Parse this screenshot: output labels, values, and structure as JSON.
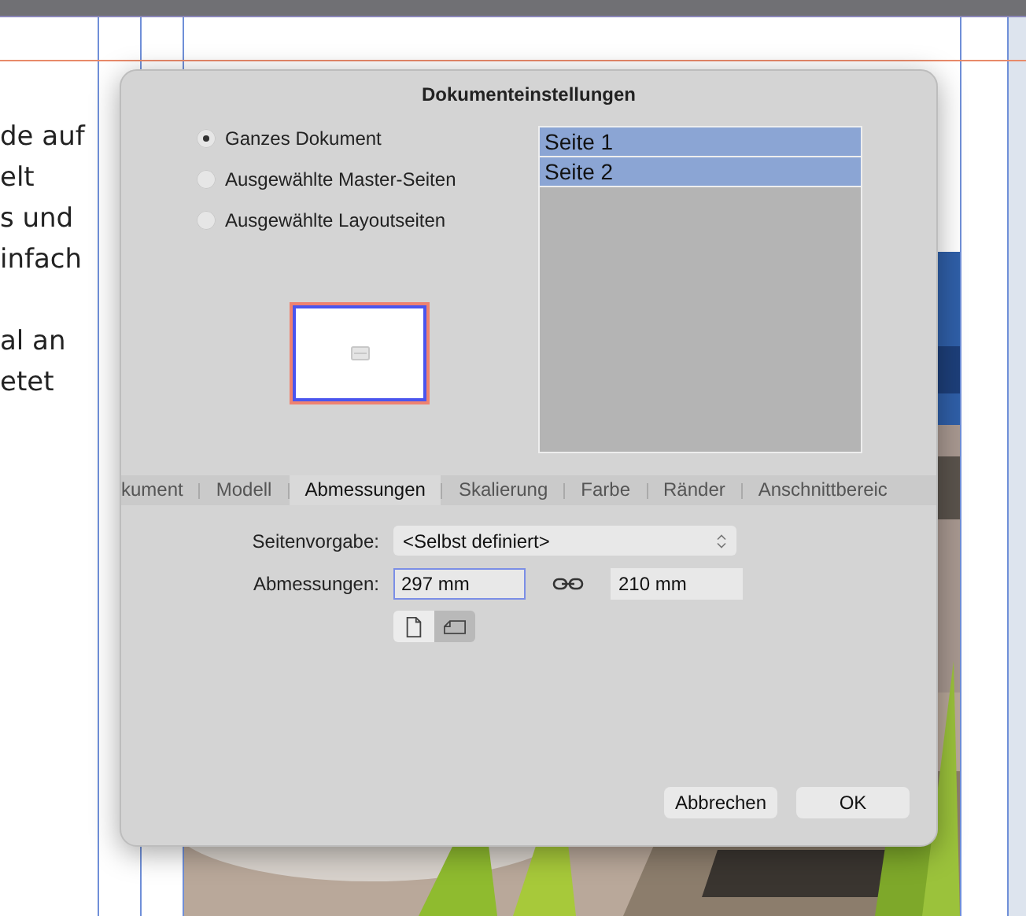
{
  "document": {
    "paragraphs": [
      [
        "de auf",
        "elt",
        "s und",
        "infach"
      ],
      [
        "al an",
        "etet"
      ]
    ]
  },
  "dialog": {
    "title": "Dokumenteinstellungen",
    "scope_options": [
      {
        "label": "Ganzes Dokument",
        "selected": true
      },
      {
        "label": "Ausgewählte Master-Seiten",
        "selected": false
      },
      {
        "label": "Ausgewählte Layoutseiten",
        "selected": false
      }
    ],
    "pages": [
      {
        "label": "Seite 1",
        "selected": true
      },
      {
        "label": "Seite 2",
        "selected": true
      }
    ],
    "tabs": [
      {
        "label": "kument",
        "selected": false
      },
      {
        "label": "Modell",
        "selected": false
      },
      {
        "label": "Abmessungen",
        "selected": true
      },
      {
        "label": "Skalierung",
        "selected": false
      },
      {
        "label": "Farbe",
        "selected": false
      },
      {
        "label": "Ränder",
        "selected": false
      },
      {
        "label": "Anschnittbereic",
        "selected": false
      }
    ],
    "fields": [
      {
        "kind": "select",
        "label": "Seitenvorgabe:",
        "value": "<Selbst definiert>"
      },
      {
        "kind": "size",
        "label": "Abmessungen:",
        "values": [
          {
            "value": "297 mm",
            "focused": true
          },
          {
            "value": "210 mm",
            "focused": false
          }
        ]
      }
    ],
    "orientation": [
      {
        "kind": "portrait",
        "selected": false
      },
      {
        "kind": "landscape",
        "selected": true
      }
    ],
    "buttons": [
      "Abbrechen",
      "OK"
    ]
  }
}
